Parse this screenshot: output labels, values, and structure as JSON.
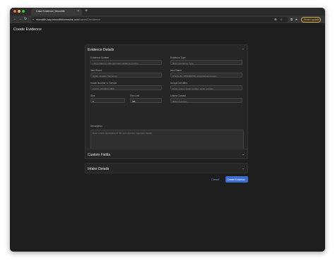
{
  "browser": {
    "tab_title": "Case Evidence | Monolith",
    "url_host": "monolith-app.monolithforensics.com",
    "url_path": "/cases/1/evidence",
    "finish_update_label": "Finish update",
    "window_controls": {
      "close_color": "#ff5f57",
      "minimize_color": "#febc2e",
      "zoom_color": "#28c840"
    }
  },
  "page": {
    "title": "Create Evidence"
  },
  "evidence_details": {
    "header": "Evidence Details",
    "fields": {
      "evidence_number": {
        "label": "Evidence Number",
        "placeholder": "Leave blank to auto-generate evidence number"
      },
      "evidence_type": {
        "label": "Evidence Type",
        "placeholder": "Select Evidence Type"
      },
      "item_brand": {
        "label": "Item Brand",
        "placeholder": "Apple, Google, Samsung..."
      },
      "item_name": {
        "label": "Item Name",
        "placeholder": "iPhone 8s, WD3458789, Gmail Email Account..."
      },
      "model_number": {
        "label": "Model Number or Service",
        "placeholder": "A1234, WD3500-3456..."
      },
      "unique_identifier": {
        "label": "Unique Identifier",
        "placeholder": "Enter unique serial number, serial number..."
      },
      "size": {
        "label": "Size",
        "value": "0"
      },
      "size_unit": {
        "label": "Size Unit",
        "value": "GB"
      },
      "linked_contact": {
        "label": "Linked Contact",
        "placeholder": "Select Contact..."
      },
      "description": {
        "label": "Description",
        "placeholder": "Enter a brief description of this item and any important details."
      }
    }
  },
  "sections": {
    "custom_fields": "Custom Fields",
    "intake_details": "Intake Details"
  },
  "actions": {
    "cancel": "Cancel",
    "create": "Create Evidence"
  },
  "colors": {
    "accent": "#3b6fd4",
    "finish_update": "#e0b84a"
  }
}
